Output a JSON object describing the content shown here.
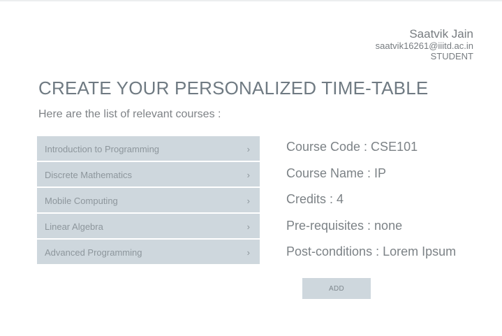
{
  "user": {
    "name": "Saatvik Jain",
    "email": "saatvik16261@iiitd.ac.in",
    "role": "STUDENT"
  },
  "page": {
    "title": "CREATE YOUR PERSONALIZED TIME-TABLE",
    "subtitle": "Here are the list of relevant courses :"
  },
  "courses": [
    {
      "label": "Introduction to Programming",
      "chevron": "›"
    },
    {
      "label": "Discrete Mathematics",
      "chevron": "›"
    },
    {
      "label": "Mobile Computing",
      "chevron": "›"
    },
    {
      "label": "Linear Algebra",
      "chevron": "›"
    },
    {
      "label": "Advanced Programming",
      "chevron": "›"
    }
  ],
  "details": {
    "code": "Course Code : CSE101",
    "name": "Course Name : IP",
    "credits": "Credits : 4",
    "prerequisites": "Pre-requisites : none",
    "postconditions": "Post-conditions : Lorem Ipsum"
  },
  "actions": {
    "add_label": "ADD"
  },
  "colors": {
    "list_item_bg": "#ced7dd",
    "title": "#6f7a82",
    "text": "#7c8286"
  }
}
